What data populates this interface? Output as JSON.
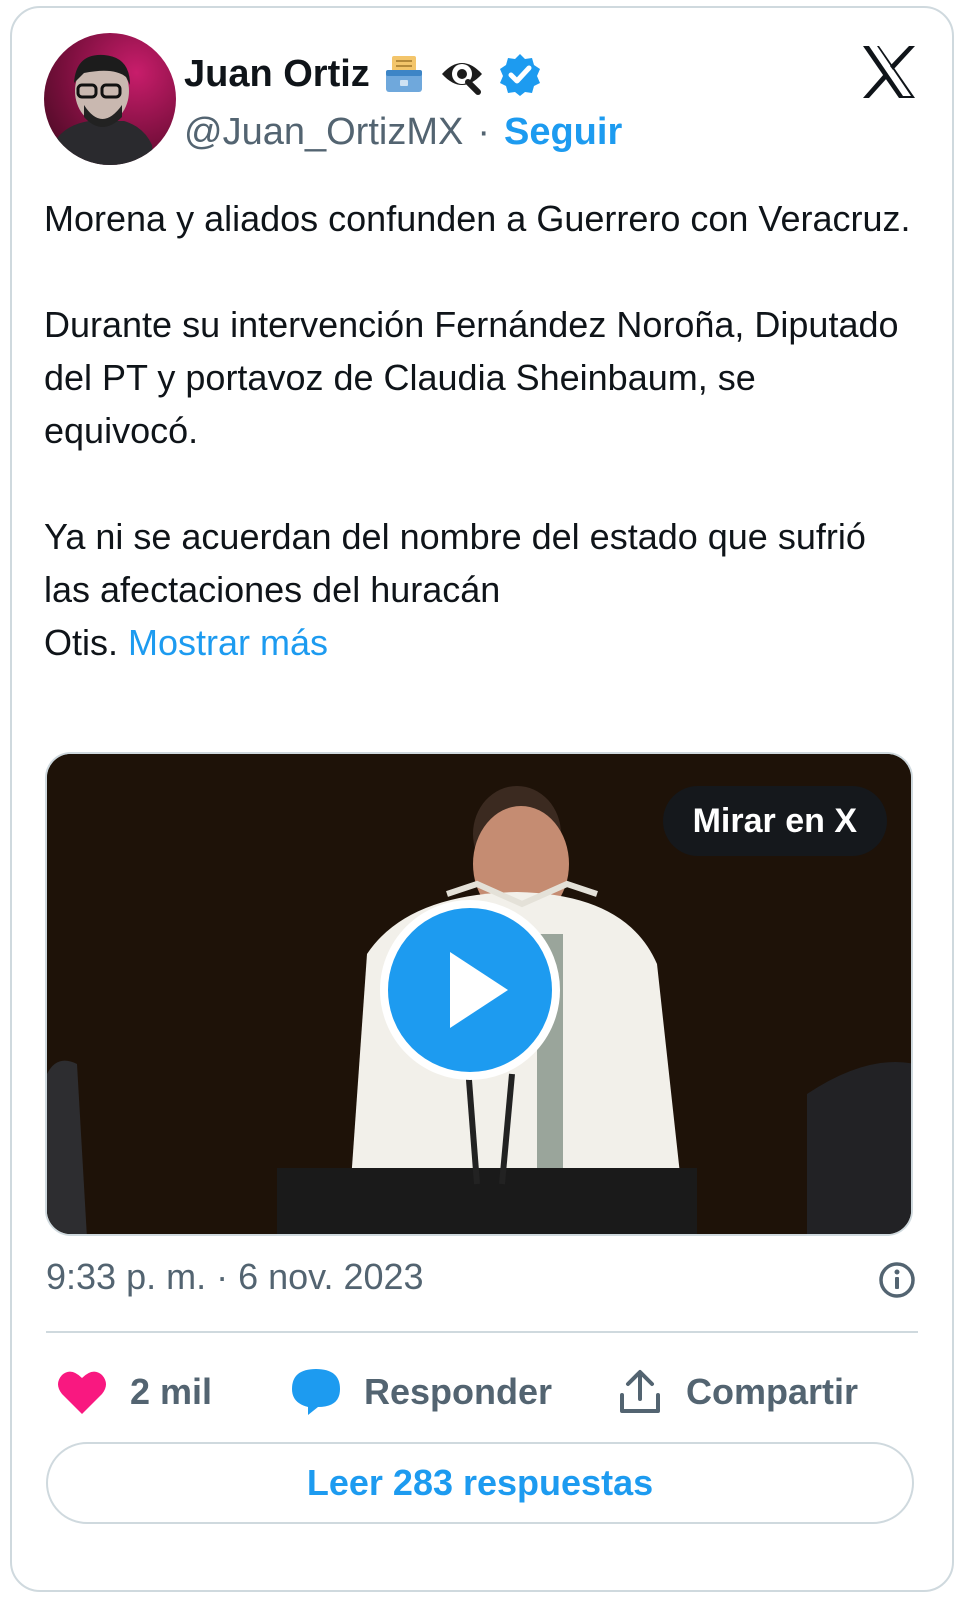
{
  "author": {
    "name": "Juan Ortiz",
    "handle": "@Juan_OrtizMX",
    "separator": "·",
    "follow_label": "Seguir",
    "badges": [
      "ballot-box-icon",
      "eye-icon",
      "verified-badge-icon"
    ]
  },
  "tweet": {
    "text": "Morena y aliados confunden a Guerrero con Veracruz.\n\nDurante su intervención Fernández Noroña, Diputado del PT y portavoz de Claudia Sheinbaum, se equivocó.\n\nYa ni se acuerdan del nombre del estado que sufrió las afectaciones del huracán\nOtis. ",
    "show_more": "Mostrar más"
  },
  "media": {
    "watch_label": "Mirar en X"
  },
  "timestamp": "9:33 p. m. · 6 nov. 2023",
  "actions": {
    "likes": "2 mil",
    "reply": "Responder",
    "share": "Compartir"
  },
  "read_replies": "Leer 283 respuestas",
  "colors": {
    "accent": "#1d9bf0",
    "like": "#f91880",
    "text": "#0f1419",
    "muted": "#536471",
    "border": "#cfd9de"
  }
}
